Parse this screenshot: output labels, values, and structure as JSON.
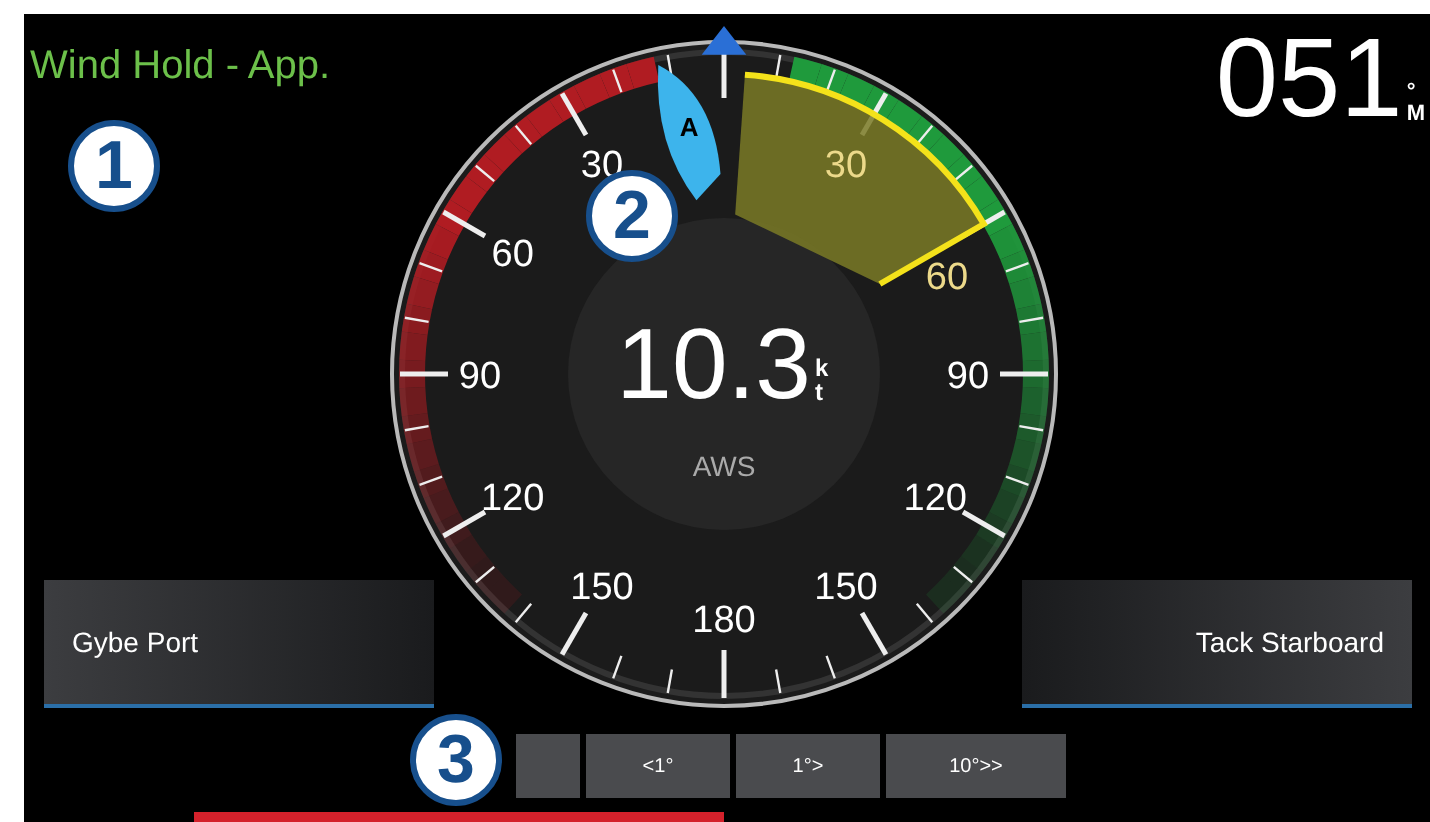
{
  "mode_title": "Wind Hold - App.",
  "heading": {
    "value": "051",
    "unit": "°M"
  },
  "gauge": {
    "marker_letter": "A",
    "speed": "10.3",
    "speed_unit": "kt",
    "speed_label": "AWS",
    "scale_labels": [
      "30",
      "60",
      "90",
      "120",
      "150",
      "180",
      "150",
      "120",
      "90",
      "60",
      "30"
    ]
  },
  "side_buttons": [
    {
      "label": "Gybe Port"
    },
    {
      "label": "Tack Starboard"
    }
  ],
  "step_buttons": [
    {
      "label": "<1°"
    },
    {
      "label": "1°>"
    },
    {
      "label": "10°>>"
    }
  ],
  "callouts": [
    "1",
    "2",
    "3"
  ]
}
